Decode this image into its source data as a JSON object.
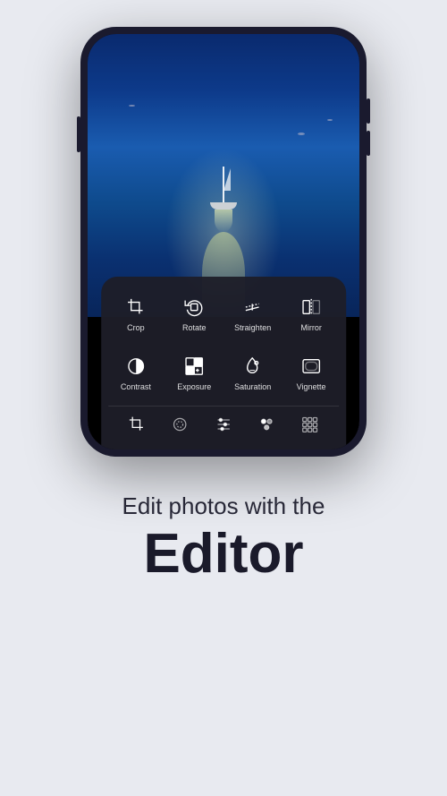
{
  "background_color": "#e8eaf0",
  "phone": {
    "tools_row1": [
      {
        "id": "crop",
        "label": "Crop",
        "icon": "crop-icon"
      },
      {
        "id": "rotate",
        "label": "Rotate",
        "icon": "rotate-icon"
      },
      {
        "id": "straighten",
        "label": "Straighten",
        "icon": "straighten-icon"
      },
      {
        "id": "mirror",
        "label": "Mirror",
        "icon": "mirror-icon"
      }
    ],
    "tools_row2": [
      {
        "id": "contrast",
        "label": "Contrast",
        "icon": "contrast-icon"
      },
      {
        "id": "exposure",
        "label": "Exposure",
        "icon": "exposure-icon"
      },
      {
        "id": "saturation",
        "label": "Saturation",
        "icon": "saturation-icon"
      },
      {
        "id": "vignette",
        "label": "Vignette",
        "icon": "vignette-icon"
      }
    ],
    "nav_icons": [
      "crop-nav-icon",
      "mask-nav-icon",
      "adjust-nav-icon",
      "paint-nav-icon",
      "grid-nav-icon"
    ]
  },
  "text_section": {
    "subtitle": "Edit photos with the",
    "title": "Editor"
  }
}
